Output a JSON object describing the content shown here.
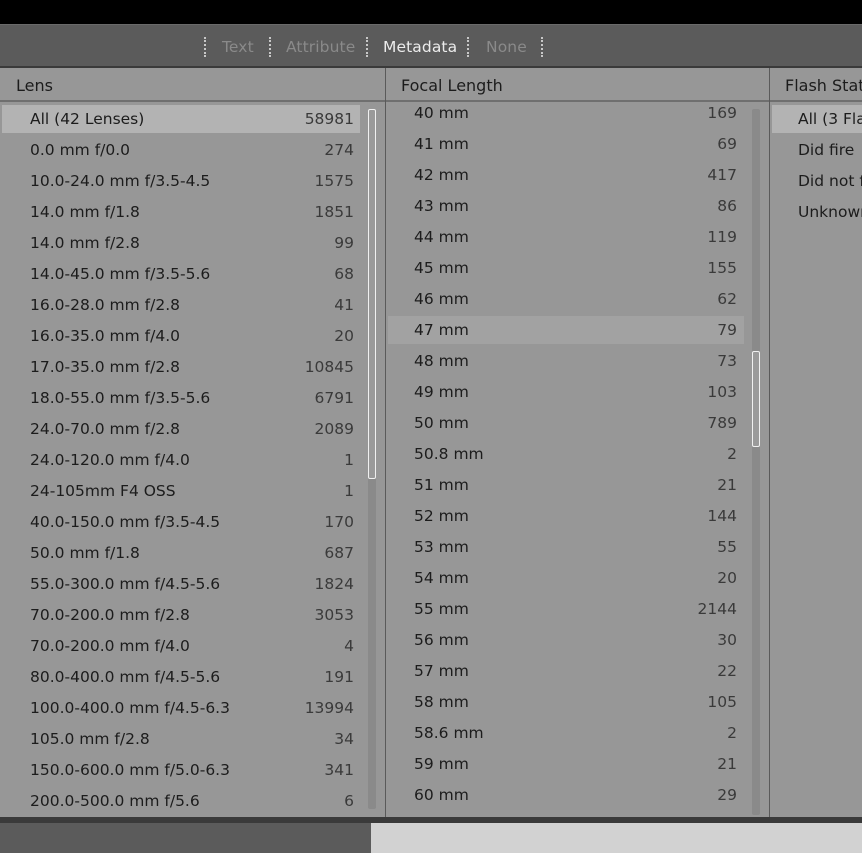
{
  "filter_bar": {
    "modes": [
      {
        "label": "Text",
        "active": false
      },
      {
        "label": "Attribute",
        "active": false
      },
      {
        "label": "Metadata",
        "active": true
      },
      {
        "label": "None",
        "active": false
      }
    ]
  },
  "columns": {
    "lens": {
      "header": "Lens",
      "items": [
        {
          "label": "All (42 Lenses)",
          "count": "58981"
        },
        {
          "label": "0.0 mm f/0.0",
          "count": "274"
        },
        {
          "label": "10.0-24.0 mm f/3.5-4.5",
          "count": "1575"
        },
        {
          "label": "14.0 mm f/1.8",
          "count": "1851"
        },
        {
          "label": "14.0 mm f/2.8",
          "count": "99"
        },
        {
          "label": "14.0-45.0 mm f/3.5-5.6",
          "count": "68"
        },
        {
          "label": "16.0-28.0 mm f/2.8",
          "count": "41"
        },
        {
          "label": "16.0-35.0 mm f/4.0",
          "count": "20"
        },
        {
          "label": "17.0-35.0 mm f/2.8",
          "count": "10845"
        },
        {
          "label": "18.0-55.0 mm f/3.5-5.6",
          "count": "6791"
        },
        {
          "label": "24.0-70.0 mm f/2.8",
          "count": "2089"
        },
        {
          "label": "24.0-120.0 mm f/4.0",
          "count": "1"
        },
        {
          "label": "24-105mm F4 OSS",
          "count": "1"
        },
        {
          "label": "40.0-150.0 mm f/3.5-4.5",
          "count": "170"
        },
        {
          "label": "50.0 mm f/1.8",
          "count": "687"
        },
        {
          "label": "55.0-300.0 mm f/4.5-5.6",
          "count": "1824"
        },
        {
          "label": "70.0-200.0 mm f/2.8",
          "count": "3053"
        },
        {
          "label": "70.0-200.0 mm f/4.0",
          "count": "4"
        },
        {
          "label": "80.0-400.0 mm f/4.5-5.6",
          "count": "191"
        },
        {
          "label": "100.0-400.0 mm f/4.5-6.3",
          "count": "13994"
        },
        {
          "label": "105.0 mm f/2.8",
          "count": "34"
        },
        {
          "label": "150.0-600.0 mm f/5.0-6.3",
          "count": "341"
        },
        {
          "label": "200.0-500.0 mm f/5.6",
          "count": "6"
        }
      ]
    },
    "focal_length": {
      "header": "Focal Length",
      "items": [
        {
          "label": "40 mm",
          "count": "169"
        },
        {
          "label": "41 mm",
          "count": "69"
        },
        {
          "label": "42 mm",
          "count": "417"
        },
        {
          "label": "43 mm",
          "count": "86"
        },
        {
          "label": "44 mm",
          "count": "119"
        },
        {
          "label": "45 mm",
          "count": "155"
        },
        {
          "label": "46 mm",
          "count": "62"
        },
        {
          "label": "47 mm",
          "count": "79"
        },
        {
          "label": "48 mm",
          "count": "73"
        },
        {
          "label": "49 mm",
          "count": "103"
        },
        {
          "label": "50 mm",
          "count": "789"
        },
        {
          "label": "50.8 mm",
          "count": "2"
        },
        {
          "label": "51 mm",
          "count": "21"
        },
        {
          "label": "52 mm",
          "count": "144"
        },
        {
          "label": "53 mm",
          "count": "55"
        },
        {
          "label": "54 mm",
          "count": "20"
        },
        {
          "label": "55 mm",
          "count": "2144"
        },
        {
          "label": "56 mm",
          "count": "30"
        },
        {
          "label": "57 mm",
          "count": "22"
        },
        {
          "label": "58 mm",
          "count": "105"
        },
        {
          "label": "58.6 mm",
          "count": "2"
        },
        {
          "label": "59 mm",
          "count": "21"
        },
        {
          "label": "60 mm",
          "count": "29"
        }
      ]
    },
    "flash_state": {
      "header": "Flash State",
      "items": [
        {
          "label": "All (3 Fla"
        },
        {
          "label": "Did fire"
        },
        {
          "label": "Did not fi"
        },
        {
          "label": "Unknown"
        }
      ]
    }
  }
}
